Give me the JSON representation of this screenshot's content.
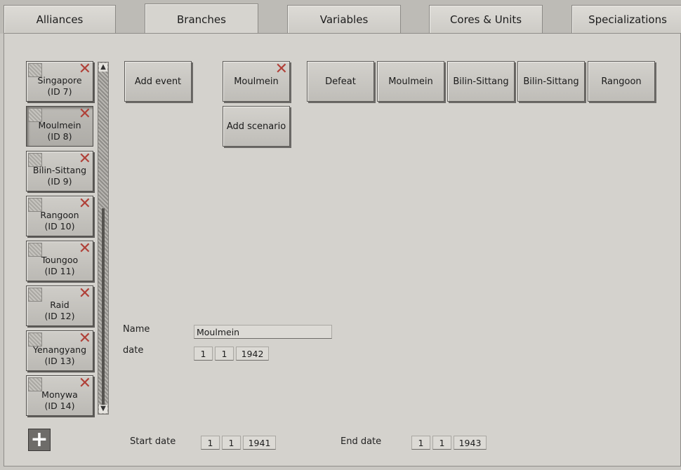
{
  "tabs": [
    "Alliances",
    "Branches",
    "Variables",
    "Cores & Units",
    "Specializations"
  ],
  "active_tab": "Branches",
  "list": [
    {
      "name": "Singapore",
      "id": "(ID 7)"
    },
    {
      "name": "Moulmein",
      "id": "(ID 8)"
    },
    {
      "name": "Bilin-Sittang",
      "id": "(ID 9)"
    },
    {
      "name": "Rangoon",
      "id": "(ID 10)"
    },
    {
      "name": "Toungoo",
      "id": "(ID 11)"
    },
    {
      "name": "Raid",
      "id": "(ID 12)"
    },
    {
      "name": "Yenangyang",
      "id": "(ID 13)"
    },
    {
      "name": "Monywa",
      "id": "(ID 14)"
    }
  ],
  "selected_item": "Moulmein",
  "add_event_label": "Add event",
  "scenario": {
    "name": "Moulmein",
    "add_label": "Add scenario"
  },
  "outcomes": [
    "Defeat",
    "Moulmein",
    "Bilin-Sittang",
    "Bilin-Sittang",
    "Rangoon"
  ],
  "detail": {
    "name_label": "Name",
    "name_value": "Moulmein",
    "date_label": "date",
    "date": {
      "day": "1",
      "month": "1",
      "year": "1942"
    }
  },
  "start_date": {
    "label": "Start date",
    "day": "1",
    "month": "1",
    "year": "1941"
  },
  "end_date": {
    "label": "End date",
    "day": "1",
    "month": "1",
    "year": "1943"
  },
  "icons": {
    "remove": "close-icon",
    "add": "plus-icon",
    "scroll_up": "arrow-up-icon",
    "scroll_down": "arrow-down-icon"
  },
  "colors": {
    "remove_icon": "#b04038",
    "panel": "#d4d2cd"
  }
}
